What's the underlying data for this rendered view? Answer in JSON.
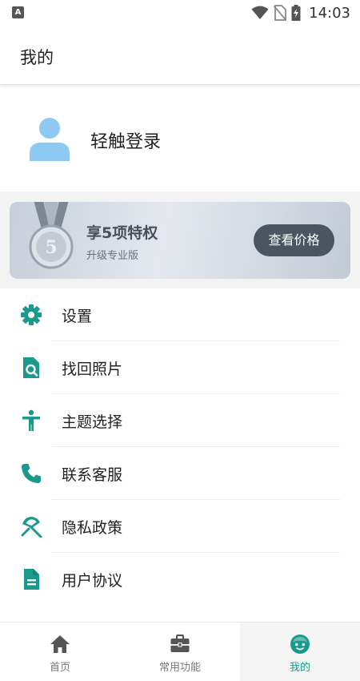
{
  "status_bar": {
    "time": "14:03",
    "notification_icon": "A"
  },
  "header": {
    "title": "我的"
  },
  "profile": {
    "login_text": "轻触登录"
  },
  "vip": {
    "title": "享5项特权",
    "subtitle": "升级专业版",
    "button_label": "查看价格",
    "medal_number": "5"
  },
  "menu": {
    "items": [
      {
        "label": "设置",
        "icon": "gear-icon"
      },
      {
        "label": "找回照片",
        "icon": "file-search-icon"
      },
      {
        "label": "主题选择",
        "icon": "accessibility-icon"
      },
      {
        "label": "联系客服",
        "icon": "phone-icon"
      },
      {
        "label": "隐私政策",
        "icon": "umbrella-icon"
      },
      {
        "label": "用户协议",
        "icon": "document-icon"
      }
    ]
  },
  "bottom_nav": {
    "items": [
      {
        "label": "首页",
        "icon": "home-icon"
      },
      {
        "label": "常用功能",
        "icon": "briefcase-icon"
      },
      {
        "label": "我的",
        "icon": "face-icon"
      }
    ],
    "active_index": 2
  },
  "colors": {
    "accent": "#1a9a8c",
    "avatar": "#8ec9f1",
    "vip_button": "#4a5561"
  }
}
